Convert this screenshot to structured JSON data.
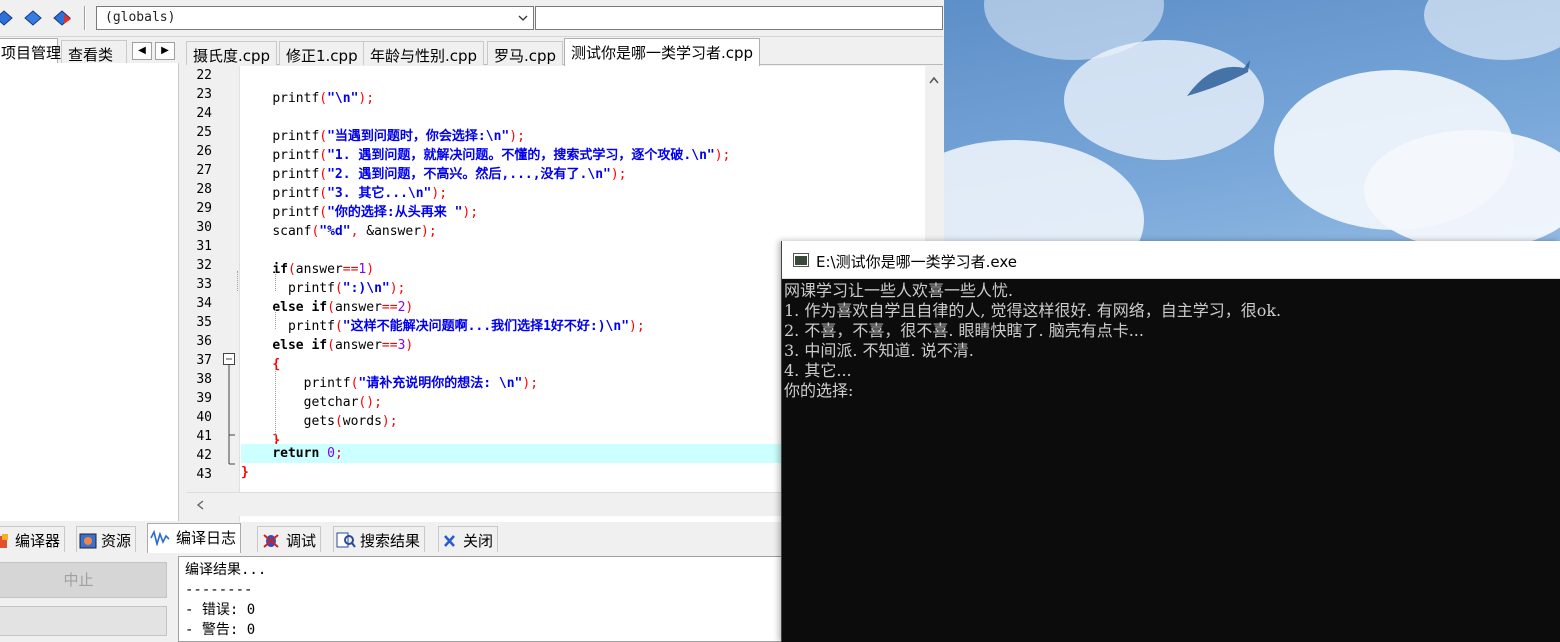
{
  "toolbar": {
    "scope": "(globals)",
    "function": ""
  },
  "left_panel": {
    "tabs": [
      "项目管理",
      "查看类"
    ]
  },
  "file_tabs": [
    "摄氏度.cpp",
    "修正1.cpp",
    "年龄与性别.cpp",
    "罗马.cpp",
    "测试你是哪一类学习者.cpp"
  ],
  "active_file": 4,
  "editor": {
    "line_numbers": [
      "22",
      "23",
      "24",
      "25",
      "26",
      "27",
      "28",
      "29",
      "30",
      "31",
      "32",
      "33",
      "34",
      "35",
      "36",
      "37",
      "38",
      "39",
      "40",
      "41",
      "42",
      "43"
    ],
    "lines": {
      "l23": "printf",
      "l23s": "\"\\n\"",
      "l25s": "\"当遇到问题时，你会选择:\\n\"",
      "l26s": "\"1. 遇到问题，就解决问题。不懂的，搜索式学习，逐个攻破.\\n\"",
      "l27s": "\"2. 遇到问题，不高兴。然后,...,没有了.\\n\"",
      "l28s": "\"3. 其它...\\n\"",
      "l29s": "\"你的选择:从头再来 \"",
      "l30a": "scanf",
      "l30s": "\"%d\"",
      "l30b": "&answer",
      "l32k": "if",
      "l32b": "answer",
      "l32c": "==",
      "l32n": "1",
      "l33s": "\":)\\n\"",
      "l34k": "else if",
      "l34n": "2",
      "l35s": "\"这样不能解决问题啊...我们选择1好不好:)\\n\"",
      "l36n": "3",
      "l38s": "\"请补充说明你的想法: \\n\"",
      "l39": "getchar",
      "l40a": "gets",
      "l40b": "words",
      "l42k": "return",
      "l42n": "0"
    }
  },
  "bottom_tabs": [
    "编译器",
    "资源",
    "编译日志",
    "调试",
    "搜索结果",
    "关闭"
  ],
  "buttons": {
    "stop": "中止"
  },
  "log": [
    "编译结果...",
    "--------",
    "- 错误: 0",
    "- 警告: 0"
  ],
  "console": {
    "title": "E:\\测试你是哪一类学习者.exe",
    "lines": [
      "网课学习让一些人欢喜一些人忧.",
      "1. 作为喜欢自学且自律的人, 觉得这样很好. 有网络，自主学习，很ok.",
      "2. 不喜，不喜，很不喜. 眼睛快瞎了. 脑壳有点卡...",
      "3. 中间派. 不知道. 说不清.",
      "4. 其它...",
      "你的选择:"
    ]
  }
}
